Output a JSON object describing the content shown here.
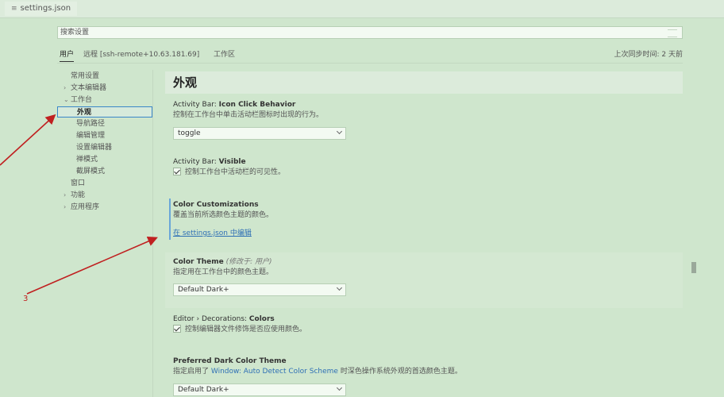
{
  "tabbar": {
    "tab_icon": "≡",
    "tab_label": "settings.json"
  },
  "search": {
    "placeholder": "搜索设置"
  },
  "scopes": {
    "user": "用户",
    "remote": "远程 [ssh-remote+10.63.181.69]",
    "workspace": "工作区",
    "sync_status": "上次同步时间: 2 天前"
  },
  "toc": {
    "items": [
      {
        "label": "常用设置",
        "chev": ""
      },
      {
        "label": "文本编辑器",
        "chev": "›"
      },
      {
        "label": "工作台",
        "chev": "⌄"
      },
      {
        "label": "外观",
        "chev": ""
      },
      {
        "label": "导航路径",
        "chev": ""
      },
      {
        "label": "编辑管理",
        "chev": ""
      },
      {
        "label": "设置编辑器",
        "chev": ""
      },
      {
        "label": "禅模式",
        "chev": ""
      },
      {
        "label": "截屏模式",
        "chev": ""
      },
      {
        "label": "窗口",
        "chev": ""
      },
      {
        "label": "功能",
        "chev": "›"
      },
      {
        "label": "应用程序",
        "chev": "›"
      }
    ]
  },
  "content": {
    "section_title": "外观",
    "settings": {
      "activity_bar_click": {
        "prefix": "Activity Bar: ",
        "name": "Icon Click Behavior",
        "desc": "控制在工作台中单击活动栏图标时出现的行为。",
        "value": "toggle"
      },
      "activity_bar_visible": {
        "prefix": "Activity Bar: ",
        "name": "Visible",
        "check_label": "控制工作台中活动栏的可见性。"
      },
      "color_customizations": {
        "name": "Color Customizations",
        "desc": "覆盖当前所选颜色主题的颜色。",
        "edit_link": "在 settings.json 中编辑"
      },
      "color_theme": {
        "name": "Color Theme",
        "modified": "(修改于: 用户)",
        "desc": "指定用在工作台中的颜色主题。",
        "value": "Default Dark+"
      },
      "editor_decorations": {
        "prefix": "Editor › Decorations: ",
        "name": "Colors",
        "check_label": "控制编辑器文件修饰是否应使用颜色。"
      },
      "preferred_dark": {
        "name": "Preferred Dark Color Theme",
        "desc_before": "指定启用了 ",
        "desc_link": "Window: Auto Detect Color Scheme",
        "desc_after": " 时深色操作系统外观的首选颜色主题。",
        "value": "Default Dark+"
      }
    }
  },
  "annotation": {
    "label": "3",
    "color": "#c02020"
  }
}
